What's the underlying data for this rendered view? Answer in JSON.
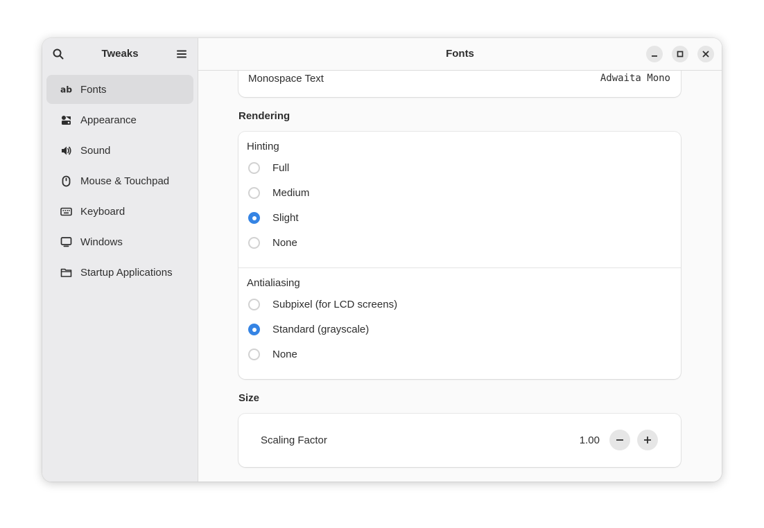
{
  "sidebar": {
    "title": "Tweaks",
    "items": [
      {
        "label": "Fonts",
        "icon": "fonts-icon"
      },
      {
        "label": "Appearance",
        "icon": "appearance-icon"
      },
      {
        "label": "Sound",
        "icon": "speaker-icon"
      },
      {
        "label": "Mouse & Touchpad",
        "icon": "mouse-icon"
      },
      {
        "label": "Keyboard",
        "icon": "keyboard-icon"
      },
      {
        "label": "Windows",
        "icon": "monitor-icon"
      },
      {
        "label": "Startup Applications",
        "icon": "folder-icon"
      }
    ],
    "selected": "Fonts"
  },
  "header": {
    "title": "Fonts"
  },
  "fonts": {
    "monospace": {
      "label": "Monospace Text",
      "value": "Adwaita Mono"
    }
  },
  "rendering": {
    "title": "Rendering",
    "hinting": {
      "title": "Hinting",
      "options": [
        "Full",
        "Medium",
        "Slight",
        "None"
      ],
      "selected": "Slight"
    },
    "antialiasing": {
      "title": "Antialiasing",
      "options": [
        "Subpixel (for LCD screens)",
        "Standard (grayscale)",
        "None"
      ],
      "selected": "Standard (grayscale)"
    }
  },
  "size": {
    "title": "Size",
    "scaling_label": "Scaling Factor",
    "scaling_value": "1.00"
  },
  "colors": {
    "accent": "#3584e4",
    "sidebar_bg": "#ebebed",
    "selected_bg": "#dcdcde"
  }
}
